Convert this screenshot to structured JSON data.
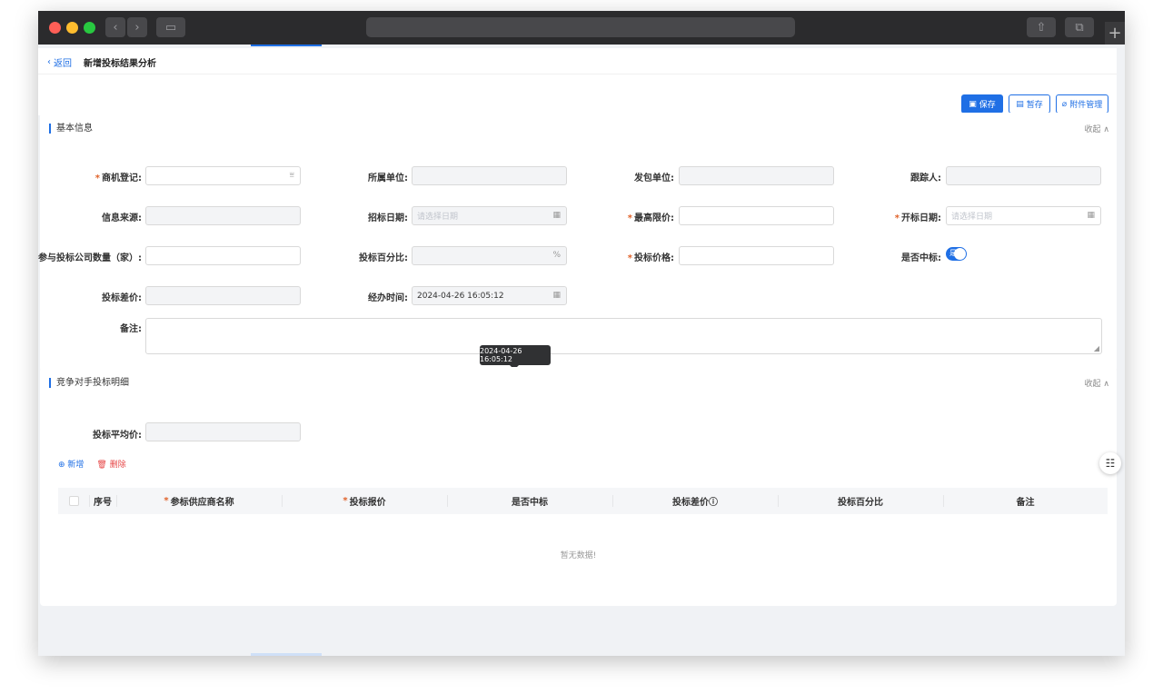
{
  "browser": {
    "back_glyph": "‹",
    "forward_glyph": "›",
    "sidebar_glyph": "▭",
    "share_glyph": "⇧",
    "tabs_glyph": "⧉",
    "plus_glyph": "+"
  },
  "header": {
    "back_label": "返回",
    "back_glyph": "‹",
    "title": "新增投标结果分析",
    "buttons": {
      "save": "保存",
      "draft": "暂存",
      "attachments": "附件管理"
    }
  },
  "basic_info": {
    "title": "基本信息",
    "collapse": "收起 ∧",
    "fields": {
      "opportunity": {
        "label": "商机登记:",
        "required": true,
        "value": ""
      },
      "unit": {
        "label": "所属单位:",
        "value": ""
      },
      "contractor": {
        "label": "发包单位:",
        "value": ""
      },
      "follower": {
        "label": "跟踪人:",
        "value": ""
      },
      "source": {
        "label": "信息来源:",
        "value": ""
      },
      "bid_date": {
        "label": "招标日期:",
        "placeholder": "请选择日期"
      },
      "max_price": {
        "label": "最高限价:",
        "required": true,
        "value": ""
      },
      "open_date": {
        "label": "开标日期:",
        "required": true,
        "placeholder": "请选择日期"
      },
      "company_count": {
        "label": "参与投标公司数量（家）:",
        "value": ""
      },
      "bid_percent": {
        "label": "投标百分比:",
        "suffix": "%"
      },
      "bid_price": {
        "label": "投标价格:",
        "required": true,
        "value": ""
      },
      "won": {
        "label": "是否中标:",
        "switch_text": "是"
      },
      "bid_diff": {
        "label": "投标差价:",
        "value": ""
      },
      "handle_time": {
        "label": "经办时间:",
        "value": "2024-04-26 16:05:12"
      },
      "remark": {
        "label": "备注:"
      }
    },
    "tooltip": "2024-04-26 16:05:12"
  },
  "competitor": {
    "title": "竞争对手投标明细",
    "collapse": "收起 ∧",
    "avg_label": "投标平均价:",
    "add_label": "⊕ 新增",
    "delete_label": "🗑 删除",
    "columns": [
      "序号",
      "参标供应商名称",
      "投标报价",
      "是否中标",
      "投标差价ⓘ",
      "投标百分比",
      "备注"
    ],
    "empty_text": "暂无数据!"
  },
  "float_glyph": "☷",
  "colors": {
    "primary": "#1f6fe5",
    "required": "#e0622a",
    "danger": "#e64545"
  }
}
